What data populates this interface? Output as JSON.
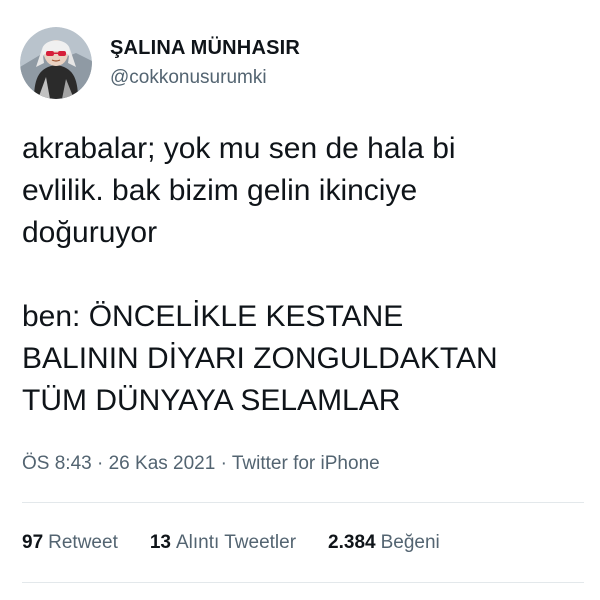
{
  "author": {
    "display_name": "ŞALINA MÜNHASIR",
    "handle": "@cokkonusurumki",
    "avatar_icon": "avatar-portrait-red-glasses"
  },
  "tweet": {
    "text": "akrabalar; yok mu sen de hala bi\nevlilik. bak bizim gelin ikinciye\ndoğuruyor\n\nben: ÖNCELİKLE KESTANE\nBALININ DİYARI ZONGULDAKTAN\nTÜM DÜNYAYA SELAMLAR",
    "time": "ÖS 8:43",
    "date": "26 Kas 2021",
    "source": "Twitter for iPhone",
    "separator": "·"
  },
  "stats": {
    "retweets_count": "97",
    "retweets_label": "Retweet",
    "quotes_count": "13",
    "quotes_label": "Alıntı Tweetler",
    "likes_count": "2.384",
    "likes_label": "Beğeni"
  },
  "colors": {
    "text_primary": "#0f1419",
    "text_secondary": "#536471",
    "divider": "#e3e8eb"
  }
}
